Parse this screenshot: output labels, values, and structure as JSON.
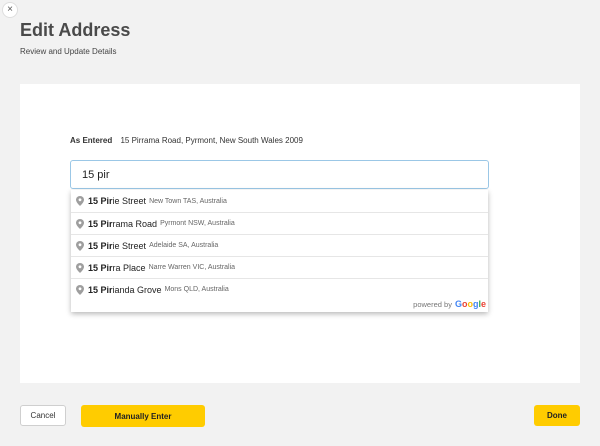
{
  "close": {
    "glyph": "×"
  },
  "header": {
    "title": "Edit Address",
    "subtitle": "Review and Update Details"
  },
  "as_entered": {
    "label": "As Entered",
    "value": "15 Pirrama Road, Pyrmont, New South Wales   2009"
  },
  "search": {
    "value": "15 pir"
  },
  "suggestions": [
    {
      "bold": "15 Pir",
      "rest": "ie Street",
      "secondary": "New Town TAS, Australia"
    },
    {
      "bold": "15 Pir",
      "rest": "rama Road",
      "secondary": "Pyrmont NSW, Australia"
    },
    {
      "bold": "15 Pir",
      "rest": "ie Street",
      "secondary": "Adelaide SA, Australia"
    },
    {
      "bold": "15 Pir",
      "rest": "ra Place",
      "secondary": "Narre Warren VIC, Australia"
    },
    {
      "bold": "15 Pir",
      "rest": "ianda Grove",
      "secondary": "Mons QLD, Australia"
    }
  ],
  "powered_by": {
    "text": "powered by",
    "logo": [
      "G",
      "o",
      "o",
      "g",
      "l",
      "e"
    ],
    "logo_colors": [
      "#4285F4",
      "#EA4335",
      "#FBBC05",
      "#4285F4",
      "#34A853",
      "#EA4335"
    ]
  },
  "icons": {
    "suggestion": "map-pin-icon",
    "close": "close-icon"
  },
  "colors": {
    "accent": "#ffcc00",
    "input_border": "#9bc7e6",
    "pin": "#9e9e9e"
  },
  "footer": {
    "cancel_label": "Cancel",
    "manual_label": "Manually Enter",
    "done_label": "Done"
  }
}
